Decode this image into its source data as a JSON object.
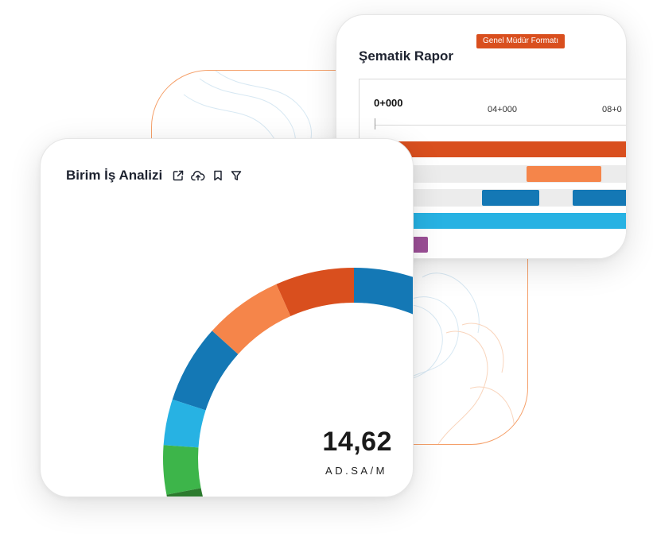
{
  "schematic_report": {
    "title": "Şematik Rapor",
    "badge": "Genel Müdür Formatı",
    "axis_ticks": [
      "0+000",
      "04+000",
      "08+0"
    ],
    "rows": [
      {
        "bars": [
          {
            "color": "#d94f1e"
          }
        ]
      },
      {
        "bars": [
          {
            "color": "#f5854a"
          }
        ]
      },
      {
        "bars": [
          {
            "color": "#1478b5"
          },
          {
            "color": "#1478b5"
          }
        ]
      },
      {
        "bars": [
          {
            "color": "#27b2e3"
          }
        ]
      },
      {
        "bars": [
          {
            "color": "#9b4f96"
          }
        ]
      }
    ]
  },
  "unit_analysis": {
    "title": "Birim İş Analizi",
    "icons": [
      "external-link-icon",
      "cloud-upload-icon",
      "bookmark-icon",
      "filter-icon"
    ],
    "value": "14,62",
    "unit": "AD.SA/M",
    "donut_colors": [
      "#1478b5",
      "#d94f1e",
      "#f5854a",
      "#1478b5",
      "#27b2e3",
      "#3db54a",
      "#2c7a2e"
    ]
  }
}
